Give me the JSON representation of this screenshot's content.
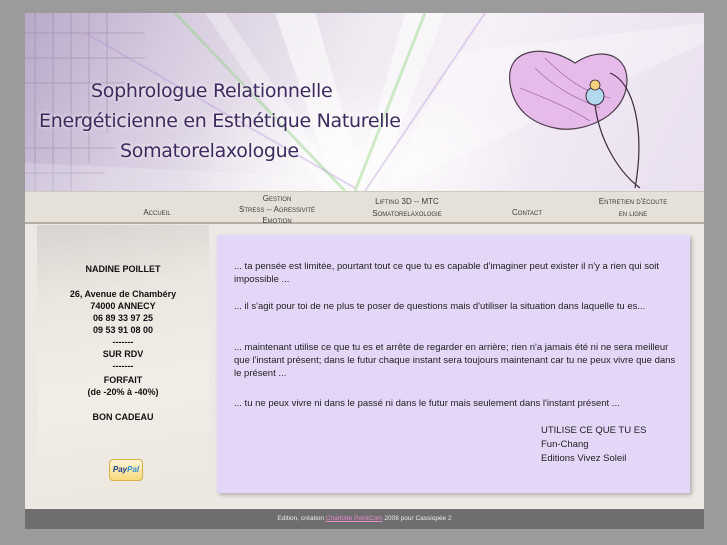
{
  "banner": {
    "title_lines": [
      "Sophrologue Relationnelle",
      "Energéticienne en Esthétique Naturelle",
      "Somatorelaxologue"
    ]
  },
  "nav": {
    "items": [
      {
        "label": "Accueil"
      },
      {
        "label_lines": [
          "Gestion",
          "Stress -- Agressivité",
          "Emotion"
        ]
      },
      {
        "label_lines": [
          "Lifting 3D -- MTC",
          "Somatorelaxologie"
        ]
      },
      {
        "label": "Contact"
      },
      {
        "label_lines": [
          "Entretien d'écoute",
          "en ligne"
        ]
      }
    ]
  },
  "sidebar": {
    "name": "NADINE POILLET",
    "address": "26, Avenue de Chambéry",
    "city": "74000 ANNECY",
    "phone1": "06 89 33 97 25",
    "phone2": "09 53 91 08 00",
    "separator": "-------",
    "rdv": "SUR RDV",
    "forfait": "FORFAIT",
    "discount": "(de -20% à -40%)",
    "gift": "BON CADEAU",
    "paypal_a": "Pay",
    "paypal_b": "Pal"
  },
  "content": {
    "paragraphs": [
      "... ta pensée est limitée, pourtant tout ce que tu es capable d'imaginer peut exister il n'y a rien qui soit impossible ...",
      "... il s'agit pour toi de ne plus te poser de questions mais d'utiliser la situation dans laquelle tu es...",
      "... maintenant utilise ce que tu es et arrête de regarder en arrière; rien n'a jamais été ni ne sera meilleur que l'instant présent; dans le futur chaque instant sera toujours maintenant car tu ne peux vivre que dans le présent ...",
      "... tu ne peux vivre ni dans le passé ni dans le futur mais seulement dans l'instant présent ..."
    ],
    "signature": [
      "UTILISE CE QUE TU ES",
      "Fun-Chang",
      "Editions Vivez Soleil"
    ]
  },
  "footer": {
    "prefix": "Edition, création",
    "link": "Charlotte PointCom",
    "suffix": "2008 pour Cassiopée 2"
  },
  "colors": {
    "content_bg": "#e4d6f7",
    "title": "#3e2a5e",
    "footer_bg": "#6e6e6e",
    "footer_link": "#e98ad0"
  }
}
